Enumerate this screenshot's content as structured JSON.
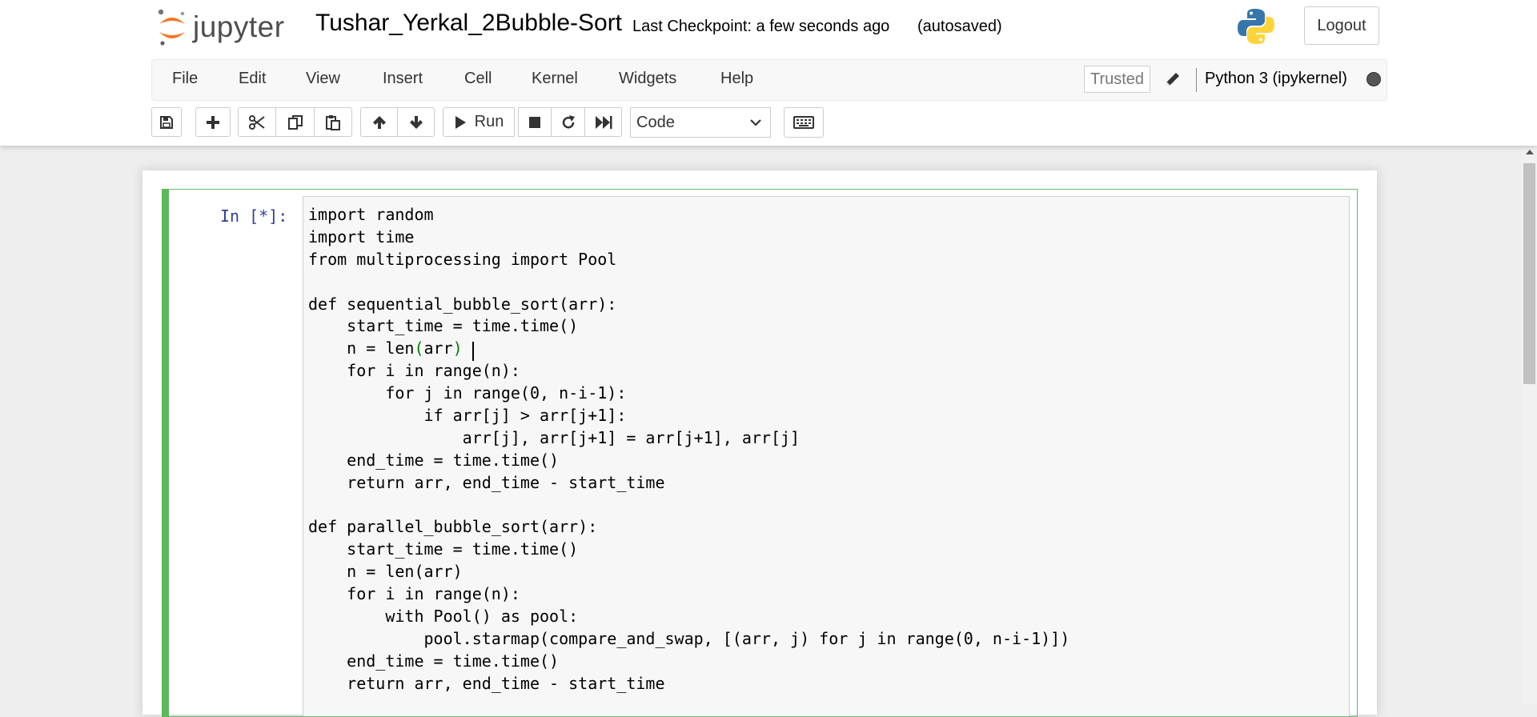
{
  "header": {
    "logo_text": "jupyter",
    "notebook_name": "Tushar_Yerkal_2Bubble-Sort",
    "checkpoint": "Last Checkpoint: a few seconds ago",
    "autosave": "(autosaved)",
    "logout_label": "Logout"
  },
  "menubar": {
    "items": [
      "File",
      "Edit",
      "View",
      "Insert",
      "Cell",
      "Kernel",
      "Widgets",
      "Help"
    ],
    "trusted_label": "Trusted",
    "kernel_name": "Python 3 (ipykernel)"
  },
  "toolbar": {
    "run_label": "Run",
    "cell_type": "Code",
    "buttons": [
      "save-icon",
      "plus-icon",
      "cut-icon",
      "copy-icon",
      "paste-icon",
      "arrow-up-icon",
      "arrow-down-icon",
      "run-icon",
      "stop-icon",
      "restart-icon",
      "fast-forward-icon",
      "keyboard-icon"
    ]
  },
  "cell": {
    "prompt": "In [*]:",
    "code_lines": [
      "import random",
      "import time",
      "from multiprocessing import Pool",
      "",
      "def sequential_bubble_sort(arr):",
      "    start_time = time.time()",
      "    n = len(arr)",
      "    for i in range(n):",
      "        for j in range(0, n-i-1):",
      "            if arr[j] > arr[j+1]:",
      "                arr[j], arr[j+1] = arr[j+1], arr[j]",
      "    end_time = time.time()",
      "    return arr, end_time - start_time",
      "",
      "def parallel_bubble_sort(arr):",
      "    start_time = time.time()",
      "    n = len(arr)",
      "    for i in range(n):",
      "        with Pool() as pool:",
      "            pool.starmap(compare_and_swap, [(arr, j) for j in range(0, n-i-1)])",
      "    end_time = time.time()",
      "    return arr, end_time - start_time"
    ]
  },
  "colors": {
    "cell_border": "#5cb85c",
    "prompt": "#303f9f",
    "bracket_match": "#008000"
  }
}
